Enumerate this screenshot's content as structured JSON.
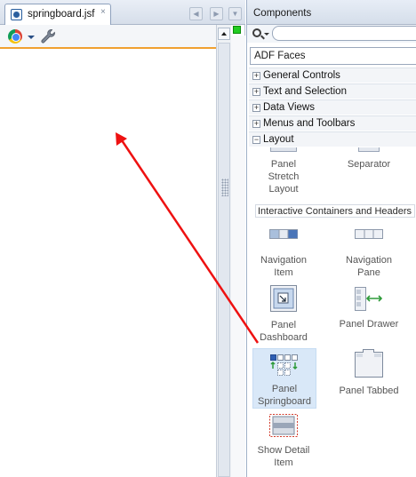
{
  "editor": {
    "tab": {
      "label": "springboard.jsf",
      "close": "×",
      "icon": "jsf-file-icon"
    },
    "tab_nav": {
      "left": "◀",
      "right": "▶",
      "menu": "▼"
    },
    "toolbar": {
      "browser_icon": "chrome-icon",
      "tools_icon": "wrench-icon"
    },
    "status_marker_color": "#22cc22",
    "toolbar_underline_color": "#f0a030"
  },
  "components": {
    "title": "Components",
    "search": {
      "value": "",
      "placeholder": ""
    },
    "library_select": "ADF Faces",
    "categories": [
      {
        "label": "General Controls",
        "state": "+"
      },
      {
        "label": "Text and Selection",
        "state": "+"
      },
      {
        "label": "Data Views",
        "state": "+"
      },
      {
        "label": "Menus and Toolbars",
        "state": "+"
      },
      {
        "label": "Layout",
        "state": "−"
      }
    ],
    "layout_items_top": [
      {
        "line1": "Panel",
        "line2": "Stretch",
        "line3": "Layout"
      },
      {
        "line1": "Separator"
      }
    ],
    "section_header": "Interactive Containers and Headers",
    "items": [
      {
        "line1": "Navigation",
        "line2": "Item",
        "icon": "navigation-item-icon"
      },
      {
        "line1": "Navigation",
        "line2": "Pane",
        "icon": "navigation-pane-icon"
      },
      {
        "line1": "Panel",
        "line2": "Dashboard",
        "icon": "panel-dashboard-icon"
      },
      {
        "line1": "Panel Drawer",
        "icon": "panel-drawer-icon"
      },
      {
        "line1": "Panel",
        "line2": "Springboard",
        "icon": "panel-springboard-icon",
        "selected": true
      },
      {
        "line1": "Panel Tabbed",
        "icon": "panel-tabbed-icon"
      },
      {
        "line1": "Show Detail",
        "line2": "Item",
        "icon": "show-detail-item-icon"
      }
    ],
    "selection_color": "#d9e8f8"
  },
  "annotation": {
    "arrow_color": "#ee1111"
  }
}
